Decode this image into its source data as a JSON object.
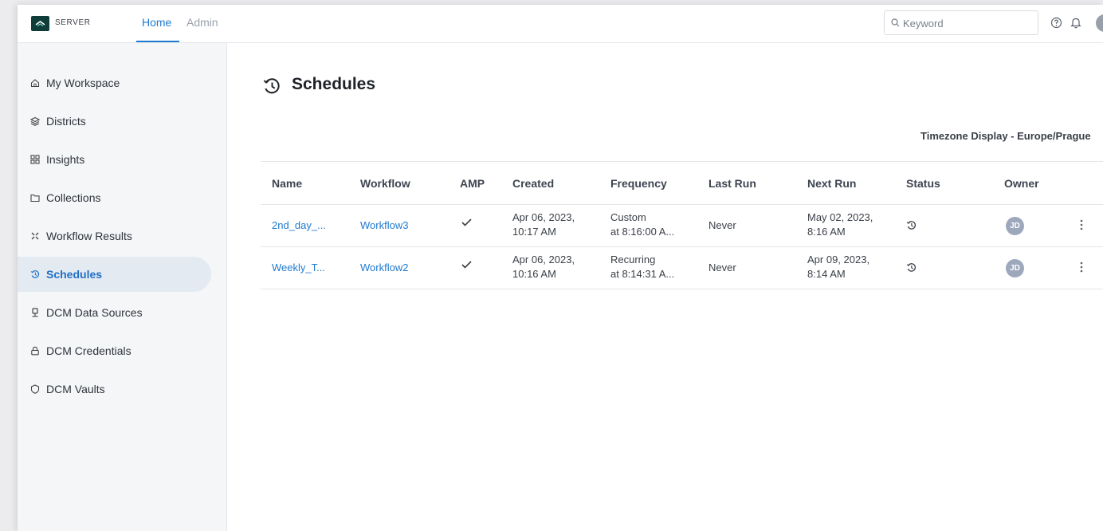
{
  "header": {
    "brand": "SERVER",
    "nav": [
      {
        "label": "Home",
        "active": true
      },
      {
        "label": "Admin",
        "active": false
      }
    ],
    "search": {
      "placeholder": "Keyword",
      "value": ""
    },
    "icons": [
      "help-icon",
      "bell-icon",
      "user-avatar"
    ]
  },
  "sidebar": {
    "items": [
      {
        "label": "My Workspace",
        "icon": "home-icon",
        "active": false
      },
      {
        "label": "Districts",
        "icon": "layers-icon",
        "active": false
      },
      {
        "label": "Insights",
        "icon": "grid-icon",
        "active": false
      },
      {
        "label": "Collections",
        "icon": "folder-icon",
        "active": false
      },
      {
        "label": "Workflow Results",
        "icon": "workflow-icon",
        "active": false
      },
      {
        "label": "Schedules",
        "icon": "history-icon",
        "active": true
      },
      {
        "label": "DCM Data Sources",
        "icon": "datasource-icon",
        "active": false
      },
      {
        "label": "DCM Credentials",
        "icon": "lock-icon",
        "active": false
      },
      {
        "label": "DCM Vaults",
        "icon": "vault-icon",
        "active": false
      }
    ]
  },
  "main": {
    "title": "Schedules",
    "timezone": "Timezone Display - Europe/Prague",
    "columns": [
      "Name",
      "Workflow",
      "AMP",
      "Created",
      "Frequency",
      "Last Run",
      "Next Run",
      "Status",
      "Owner"
    ],
    "rows": [
      {
        "name": "2nd_day_...",
        "workflow": "Workflow3",
        "amp": true,
        "created_date": "Apr 06, 2023,",
        "created_time": "10:17 AM",
        "frequency_type": "Custom",
        "frequency_detail": "at 8:16:00 A...",
        "last_run": "Never",
        "next_run_date": "May 02, 2023,",
        "next_run_time": "8:16 AM",
        "owner": "JD"
      },
      {
        "name": "Weekly_T...",
        "workflow": "Workflow2",
        "amp": true,
        "created_date": "Apr 06, 2023,",
        "created_time": "10:16 AM",
        "frequency_type": "Recurring",
        "frequency_detail": "at 8:14:31 A...",
        "last_run": "Never",
        "next_run_date": "Apr 09, 2023,",
        "next_run_time": "8:14 AM",
        "owner": "JD"
      }
    ]
  },
  "colors": {
    "accent": "#1f7ad0",
    "sidebar_bg": "#f4f6f8",
    "active_bg": "#e3eaf2",
    "logo_bg": "#0f3d3a"
  }
}
